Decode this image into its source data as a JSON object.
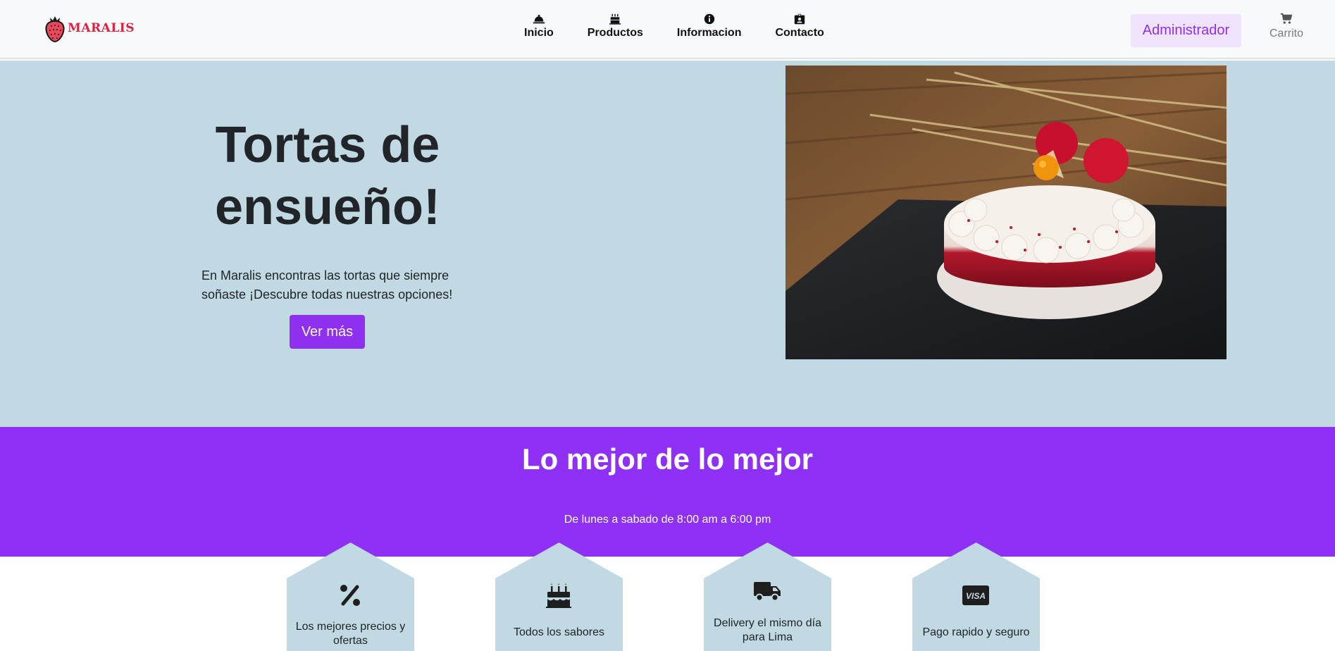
{
  "brand": {
    "name": "MARALIS",
    "color": "#e21f3f"
  },
  "nav": {
    "items": [
      {
        "label": "Inicio",
        "icon": "bell-icon"
      },
      {
        "label": "Productos",
        "icon": "cake-icon"
      },
      {
        "label": "Informacion",
        "icon": "info-icon"
      },
      {
        "label": "Contacto",
        "icon": "id-badge-icon"
      }
    ],
    "admin_label": "Administrador",
    "cart_label": "Carrito"
  },
  "hero": {
    "title": "Tortas de ensueño!",
    "text": "En Maralis encontras las tortas que siempre soñaste ¡Descubre todas nuestras opciones!",
    "button_label": "Ver más",
    "image": "red velvet cake with strawberries on slate board"
  },
  "best": {
    "title": "Lo mejor de lo mejor",
    "hours": "De lunes a sabado de 8:00 am a 6:00 pm"
  },
  "features": [
    {
      "label": "Los mejores precios y ofertas",
      "icon": "percent-icon"
    },
    {
      "label": "Todos los sabores",
      "icon": "birthday-cake-icon"
    },
    {
      "label": "Delivery el mismo día para Lima",
      "icon": "truck-icon"
    },
    {
      "label": "Pago rapido y seguro",
      "icon": "visa-card-icon"
    }
  ],
  "colors": {
    "accent": "#8f30f0",
    "hero_bg": "#c0d9e3",
    "navbar_bg": "#f8f9fa"
  }
}
